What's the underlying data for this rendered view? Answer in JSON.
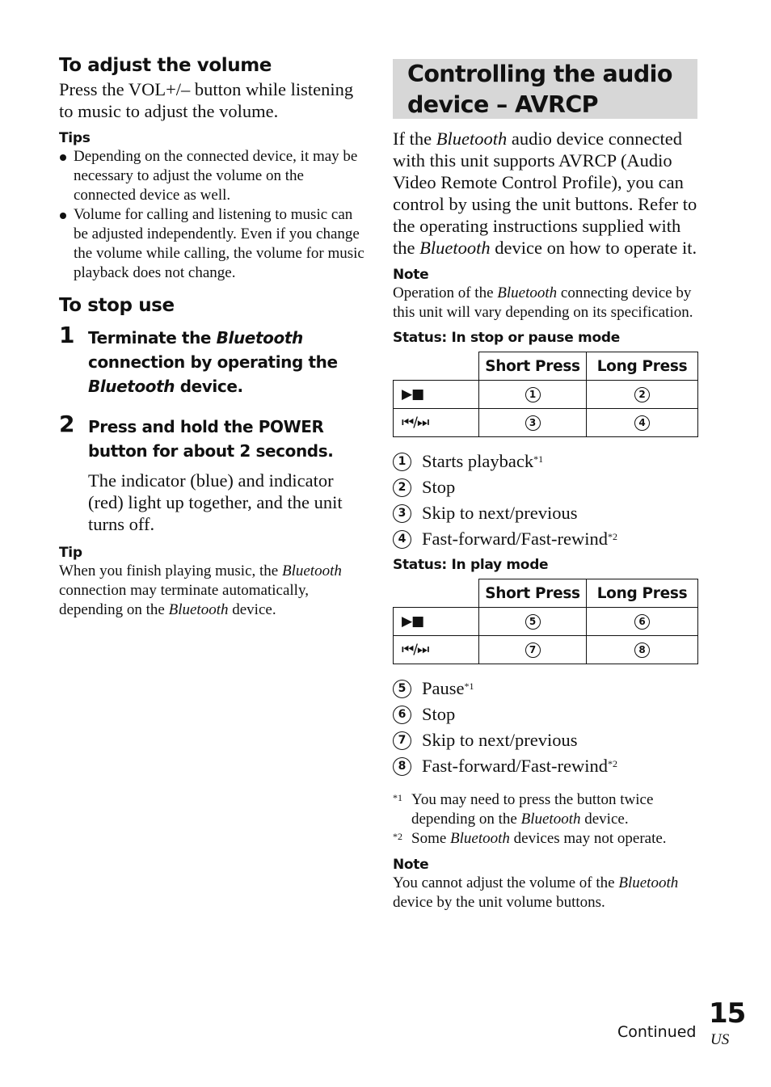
{
  "left": {
    "volume": {
      "heading": "To adjust the volume",
      "body": "Press the VOL+/– button while listening to music to adjust the volume.",
      "tips_label": "Tips",
      "tips": [
        "Depending on the connected device, it may be necessary to adjust the volume on the connected device as well.",
        "Volume for calling and listening to music can be adjusted independently. Even if you change the volume while calling, the volume for music playback does not change."
      ]
    },
    "stop": {
      "heading": "To stop use",
      "steps": [
        {
          "number": "1",
          "title_parts": [
            "Terminate the ",
            "Bluetooth",
            " connection by operating the ",
            "Bluetooth",
            " device."
          ]
        },
        {
          "number": "2",
          "title": "Press and hold the POWER button for about 2 seconds.",
          "detail": "The indicator (blue) and indicator (red) light up together, and the unit turns off."
        }
      ],
      "tip_label": "Tip",
      "tip_parts": [
        "When you finish playing music, the ",
        "Bluetooth",
        " connection may terminate automatically, depending on the ",
        "Bluetooth",
        " device."
      ]
    }
  },
  "right": {
    "title": "Controlling the audio device – AVRCP",
    "intro_parts": [
      "If the ",
      "Bluetooth",
      " audio device connected with this unit supports AVRCP (Audio Video Remote Control Profile), you can control by using the unit buttons. Refer to the operating instructions supplied with the ",
      "Bluetooth",
      " device on how to operate it."
    ],
    "note1_label": "Note",
    "note1_parts": [
      "Operation of the ",
      "Bluetooth",
      " connecting device by this unit will vary depending on its specification."
    ],
    "tables": [
      {
        "status_label": "Status: In stop or pause mode",
        "headers": [
          "",
          "Short Press",
          "Long Press"
        ],
        "rows": [
          {
            "button": "▶■",
            "button_icon": "play-stop-icon",
            "short": "1",
            "long": "2"
          },
          {
            "button": "⏮/⏭",
            "button_icon": "prev-next-icon",
            "short": "3",
            "long": "4"
          }
        ],
        "legend": [
          {
            "num": "1",
            "text": "Starts playback",
            "footnote": "*1"
          },
          {
            "num": "2",
            "text": "Stop",
            "footnote": ""
          },
          {
            "num": "3",
            "text": "Skip to next/previous",
            "footnote": ""
          },
          {
            "num": "4",
            "text": "Fast-forward/Fast-rewind",
            "footnote": "*2"
          }
        ]
      },
      {
        "status_label": "Status: In play mode",
        "headers": [
          "",
          "Short Press",
          "Long Press"
        ],
        "rows": [
          {
            "button": "▶■",
            "button_icon": "play-stop-icon",
            "short": "5",
            "long": "6"
          },
          {
            "button": "⏮/⏭",
            "button_icon": "prev-next-icon",
            "short": "7",
            "long": "8"
          }
        ],
        "legend": [
          {
            "num": "5",
            "text": "Pause",
            "footnote": "*1"
          },
          {
            "num": "6",
            "text": "Stop",
            "footnote": ""
          },
          {
            "num": "7",
            "text": "Skip to next/previous",
            "footnote": ""
          },
          {
            "num": "8",
            "text": "Fast-forward/Fast-rewind",
            "footnote": "*2"
          }
        ]
      }
    ],
    "footnotes": [
      {
        "mark": "*1",
        "parts": [
          "You may need to press the button twice depending on the ",
          "Bluetooth",
          " device."
        ]
      },
      {
        "mark": "*2",
        "parts": [
          "Some ",
          "Bluetooth",
          " devices may not operate."
        ]
      }
    ],
    "note2_label": "Note",
    "note2_parts": [
      "You cannot adjust the volume of the ",
      "Bluetooth",
      " device by the unit volume buttons."
    ]
  },
  "footer": {
    "continued": "Continued",
    "page_number": "15",
    "region": "US"
  }
}
